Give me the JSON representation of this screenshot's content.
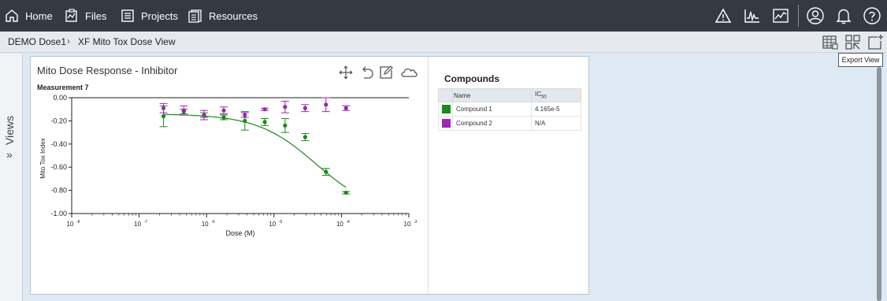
{
  "nav": {
    "home_label": "Home",
    "files_label": "Files",
    "projects_label": "Projects",
    "resources_label": "Resources",
    "icons": [
      "warning-icon",
      "waveform-icon",
      "chart-line-icon",
      "user-icon",
      "bell-icon",
      "help-icon"
    ]
  },
  "breadcrumb": {
    "items": [
      "DEMO Dose1",
      "XF Mito Tox Dose View"
    ],
    "separator": "›"
  },
  "view_toolbar": {
    "icons": [
      "table-view-icon",
      "grid-view-icon",
      "new-view-icon"
    ],
    "tooltip": "Export View"
  },
  "rail": {
    "label": "Views",
    "chevron": "»"
  },
  "panel": {
    "title": "Mito Dose Response - Inhibitor",
    "subtitle": "Measurement 7",
    "tool_icons": [
      "move-icon",
      "undo-icon",
      "edit-icon",
      "cloud-icon"
    ]
  },
  "compounds": {
    "title": "Compounds",
    "headers": [
      "Name",
      "IC",
      "50"
    ],
    "rows": [
      {
        "name": "Compound 1",
        "ic50": "4.165e-5",
        "color": "#1a8a1a"
      },
      {
        "name": "Compound 2",
        "ic50": "N/A",
        "color": "#9b27b0"
      }
    ]
  },
  "chart_data": {
    "type": "scatter",
    "title": "Mito Dose Response - Inhibitor",
    "subtitle": "Measurement 7",
    "xlabel": "Dose (M)",
    "ylabel": "Mito Tox Index",
    "x_scale": "log",
    "xlim": [
      1e-08,
      0.001
    ],
    "ylim": [
      -1.0,
      0.0
    ],
    "x_tick_labels": [
      "10",
      "10",
      "10",
      "10",
      "10",
      "10"
    ],
    "x_tick_exponents": [
      "-8",
      "-7",
      "-6",
      "-5",
      "-4",
      "-3"
    ],
    "y_tick_labels": [
      "0.00",
      "-0.20",
      "-0.40",
      "-0.60",
      "-0.80",
      "-1.00"
    ],
    "y_ticks": [
      0,
      -0.2,
      -0.4,
      -0.6,
      -0.8,
      -1.0
    ],
    "series": [
      {
        "name": "Compound 1",
        "color": "#1a8a1a",
        "x": [
          2.3e-07,
          4.6e-07,
          9.2e-07,
          1.8e-06,
          3.7e-06,
          7.3e-06,
          1.46e-05,
          2.9e-05,
          5.9e-05,
          0.000117
        ],
        "y": [
          -0.16,
          -0.12,
          -0.15,
          -0.17,
          -0.2,
          -0.21,
          -0.24,
          -0.34,
          -0.64,
          -0.82
        ],
        "err": [
          0.09,
          0.02,
          0.02,
          0.02,
          0.08,
          0.03,
          0.06,
          0.03,
          0.03,
          0.01
        ],
        "fit": true
      },
      {
        "name": "Compound 2",
        "color": "#9b27b0",
        "x": [
          2.3e-07,
          4.6e-07,
          9.2e-07,
          1.8e-06,
          3.7e-06,
          7.3e-06,
          1.46e-05,
          2.9e-05,
          5.9e-05,
          0.000117
        ],
        "y": [
          -0.09,
          -0.11,
          -0.15,
          -0.11,
          -0.15,
          -0.1,
          -0.08,
          -0.09,
          -0.06,
          -0.09
        ],
        "err": [
          0.04,
          0.04,
          0.04,
          0.03,
          0.02,
          0.01,
          0.05,
          0.03,
          0.06,
          0.02
        ],
        "fit": false
      }
    ],
    "fit_curve": {
      "series": "Compound 1",
      "top": -0.14,
      "bottom": -1.0,
      "ic50": 4.165e-05,
      "hill": 1.0,
      "x_range": [
        2.3e-07,
        0.000117
      ]
    },
    "grid": false,
    "legend": "none"
  }
}
